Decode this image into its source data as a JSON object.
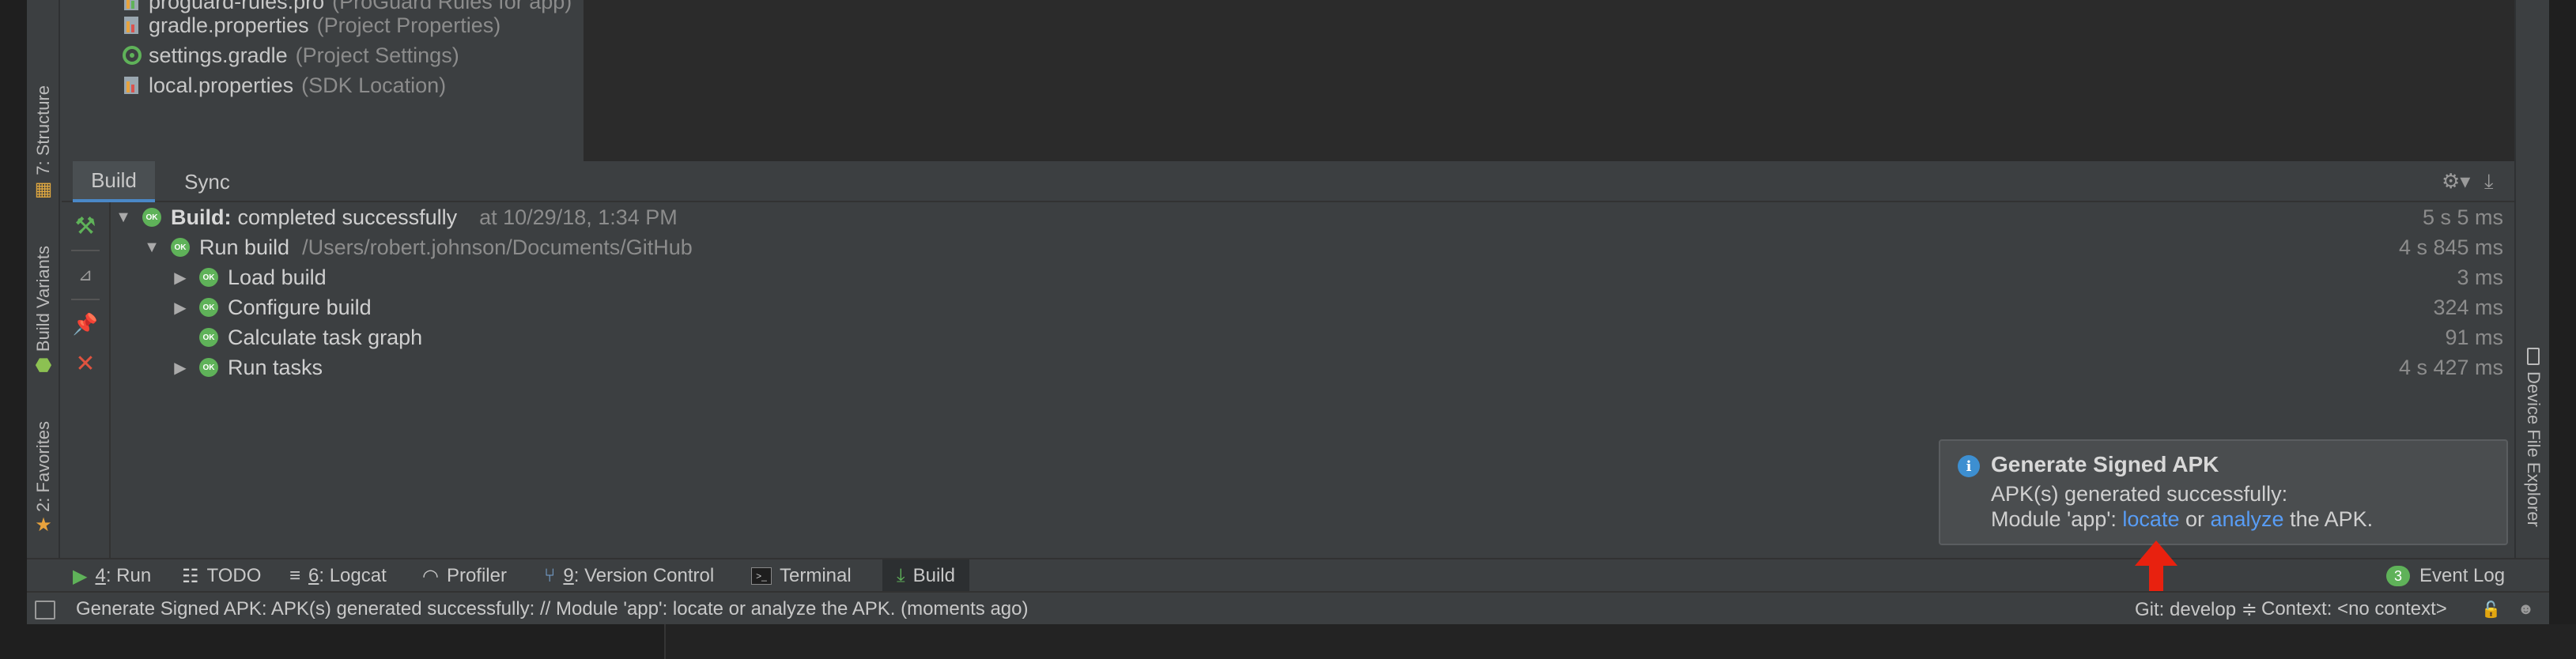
{
  "left_stripe": {
    "structure_tab": "7: Structure",
    "build_variants_tab": "Build Variants",
    "favorites_tab": "2: Favorites"
  },
  "right_stripe": {
    "device_file_explorer_tab": "Device File Explorer"
  },
  "project_tree": {
    "items": [
      {
        "name": "proguard-rules.pro",
        "hint": "(ProGuard Rules for app)"
      },
      {
        "name": "gradle.properties",
        "hint": "(Project Properties)"
      },
      {
        "name": "settings.gradle",
        "hint": "(Project Settings)"
      },
      {
        "name": "local.properties",
        "hint": "(SDK Location)"
      }
    ]
  },
  "build_window": {
    "tabs": [
      "Build",
      "Sync"
    ],
    "rows": [
      {
        "bold": "Build:",
        "label": "completed successfully",
        "sub": "at 10/29/18, 1:34 PM",
        "time": "5 s 5 ms"
      },
      {
        "label": "Run build",
        "sub": "/Users/robert.johnson/Documents/GitHub",
        "time": "4 s 845 ms"
      },
      {
        "label": "Load build",
        "time": "3 ms"
      },
      {
        "label": "Configure build",
        "time": "324 ms"
      },
      {
        "label": "Calculate task graph",
        "time": "91 ms"
      },
      {
        "label": "Run tasks",
        "time": "4 s 427 ms"
      }
    ]
  },
  "notification": {
    "title": "Generate Signed APK",
    "line1": "APK(s) generated successfully:",
    "line2_prefix": "Module 'app': ",
    "locate_link": "locate",
    "or_text": " or ",
    "analyze_link": "analyze",
    "line2_suffix": " the APK."
  },
  "bottom_tabs": {
    "run": {
      "mnemonic": "4",
      "label": ": Run"
    },
    "todo": "TODO",
    "logcat": {
      "mnemonic": "6",
      "label": ": Logcat"
    },
    "profiler": "Profiler",
    "version_control": {
      "mnemonic": "9",
      "label": ": Version Control"
    },
    "terminal": "Terminal",
    "build": "Build",
    "event_log_count": "3",
    "event_log": "Event Log"
  },
  "status_bar": {
    "message": "Generate Signed APK: APK(s) generated successfully: // Module 'app': locate or analyze the APK. (moments ago)",
    "git_branch": "Git: develop ≑",
    "context": "Context: <no context>"
  },
  "colors": {
    "accent_link": "#589df6",
    "success_green": "#5fb259",
    "info_blue": "#3d8fd1",
    "annotation_red": "#e8210f"
  }
}
